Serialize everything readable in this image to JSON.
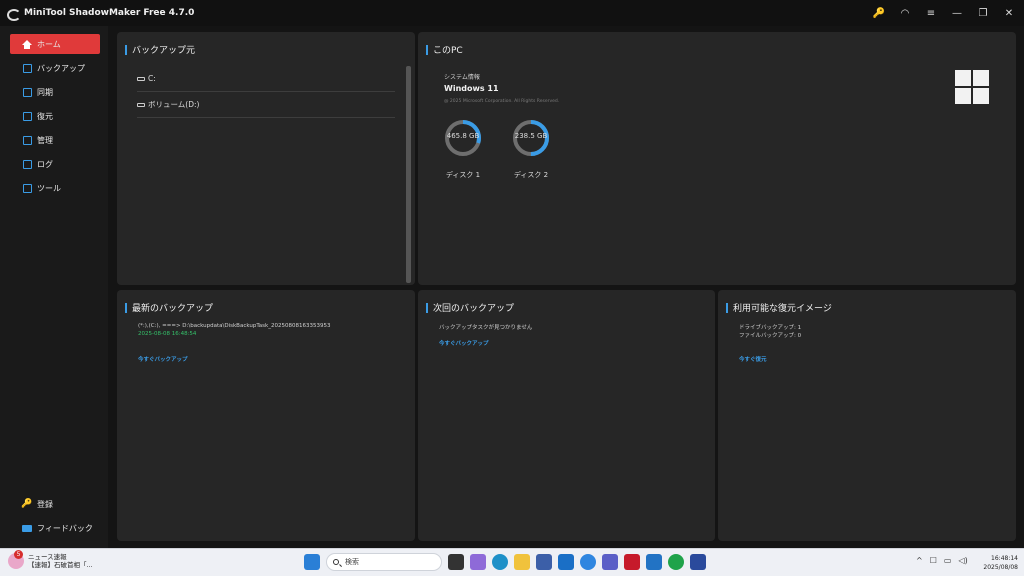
{
  "app": {
    "title": "MiniTool ShadowMaker Free 4.7.0"
  },
  "sidebar": {
    "items": [
      {
        "label": "ホーム",
        "icon": "home-icon"
      },
      {
        "label": "バックアップ",
        "icon": "backup-icon"
      },
      {
        "label": "同期",
        "icon": "sync-icon"
      },
      {
        "label": "復元",
        "icon": "restore-icon"
      },
      {
        "label": "管理",
        "icon": "manage-icon"
      },
      {
        "label": "ログ",
        "icon": "log-icon"
      },
      {
        "label": "ツール",
        "icon": "tools-icon"
      }
    ],
    "register": "登録",
    "feedback": "フィードバック"
  },
  "backup_source": {
    "title": "バックアップ元",
    "drives": [
      "C:",
      "ボリューム(D:)"
    ]
  },
  "this_pc": {
    "title": "このPC",
    "sys_label": "システム情報",
    "os": "Windows 11",
    "copyright": "@ 2025 Microsoft Corporation. All Rights Reserved.",
    "disks": [
      {
        "size": "465.8 GB",
        "label": "ディスク 1",
        "used_fraction": 0.3
      },
      {
        "size": "238.5 GB",
        "label": "ディスク 2",
        "used_fraction": 0.5
      }
    ]
  },
  "latest_backup": {
    "title": "最新のバックアップ",
    "path": "(*:),(C:), ===> D:\\backupdata\\DiskBackupTask_20250808163353953",
    "time": "2025-08-08 16:48:54",
    "action": "今すぐバックアップ"
  },
  "next_backup": {
    "title": "次回のバックアップ",
    "message": "バックアップタスクが見つかりません",
    "action": "今すぐバックアップ"
  },
  "restore_images": {
    "title": "利用可能な復元イメージ",
    "drive_backups": "ドライブバックアップ: 1",
    "file_backups": "ファイルバックアップ: 0",
    "action": "今すぐ復元"
  },
  "taskbar": {
    "news_badge": "5",
    "news_title": "ニュース速報",
    "news_sub": "【速報】石破首相「...",
    "search_placeholder": "検索",
    "time": "16:48:14",
    "date": "2025/08/08"
  },
  "colors": {
    "accent": "#3a9ce6",
    "active": "#e03a3a",
    "green": "#35c16a"
  }
}
